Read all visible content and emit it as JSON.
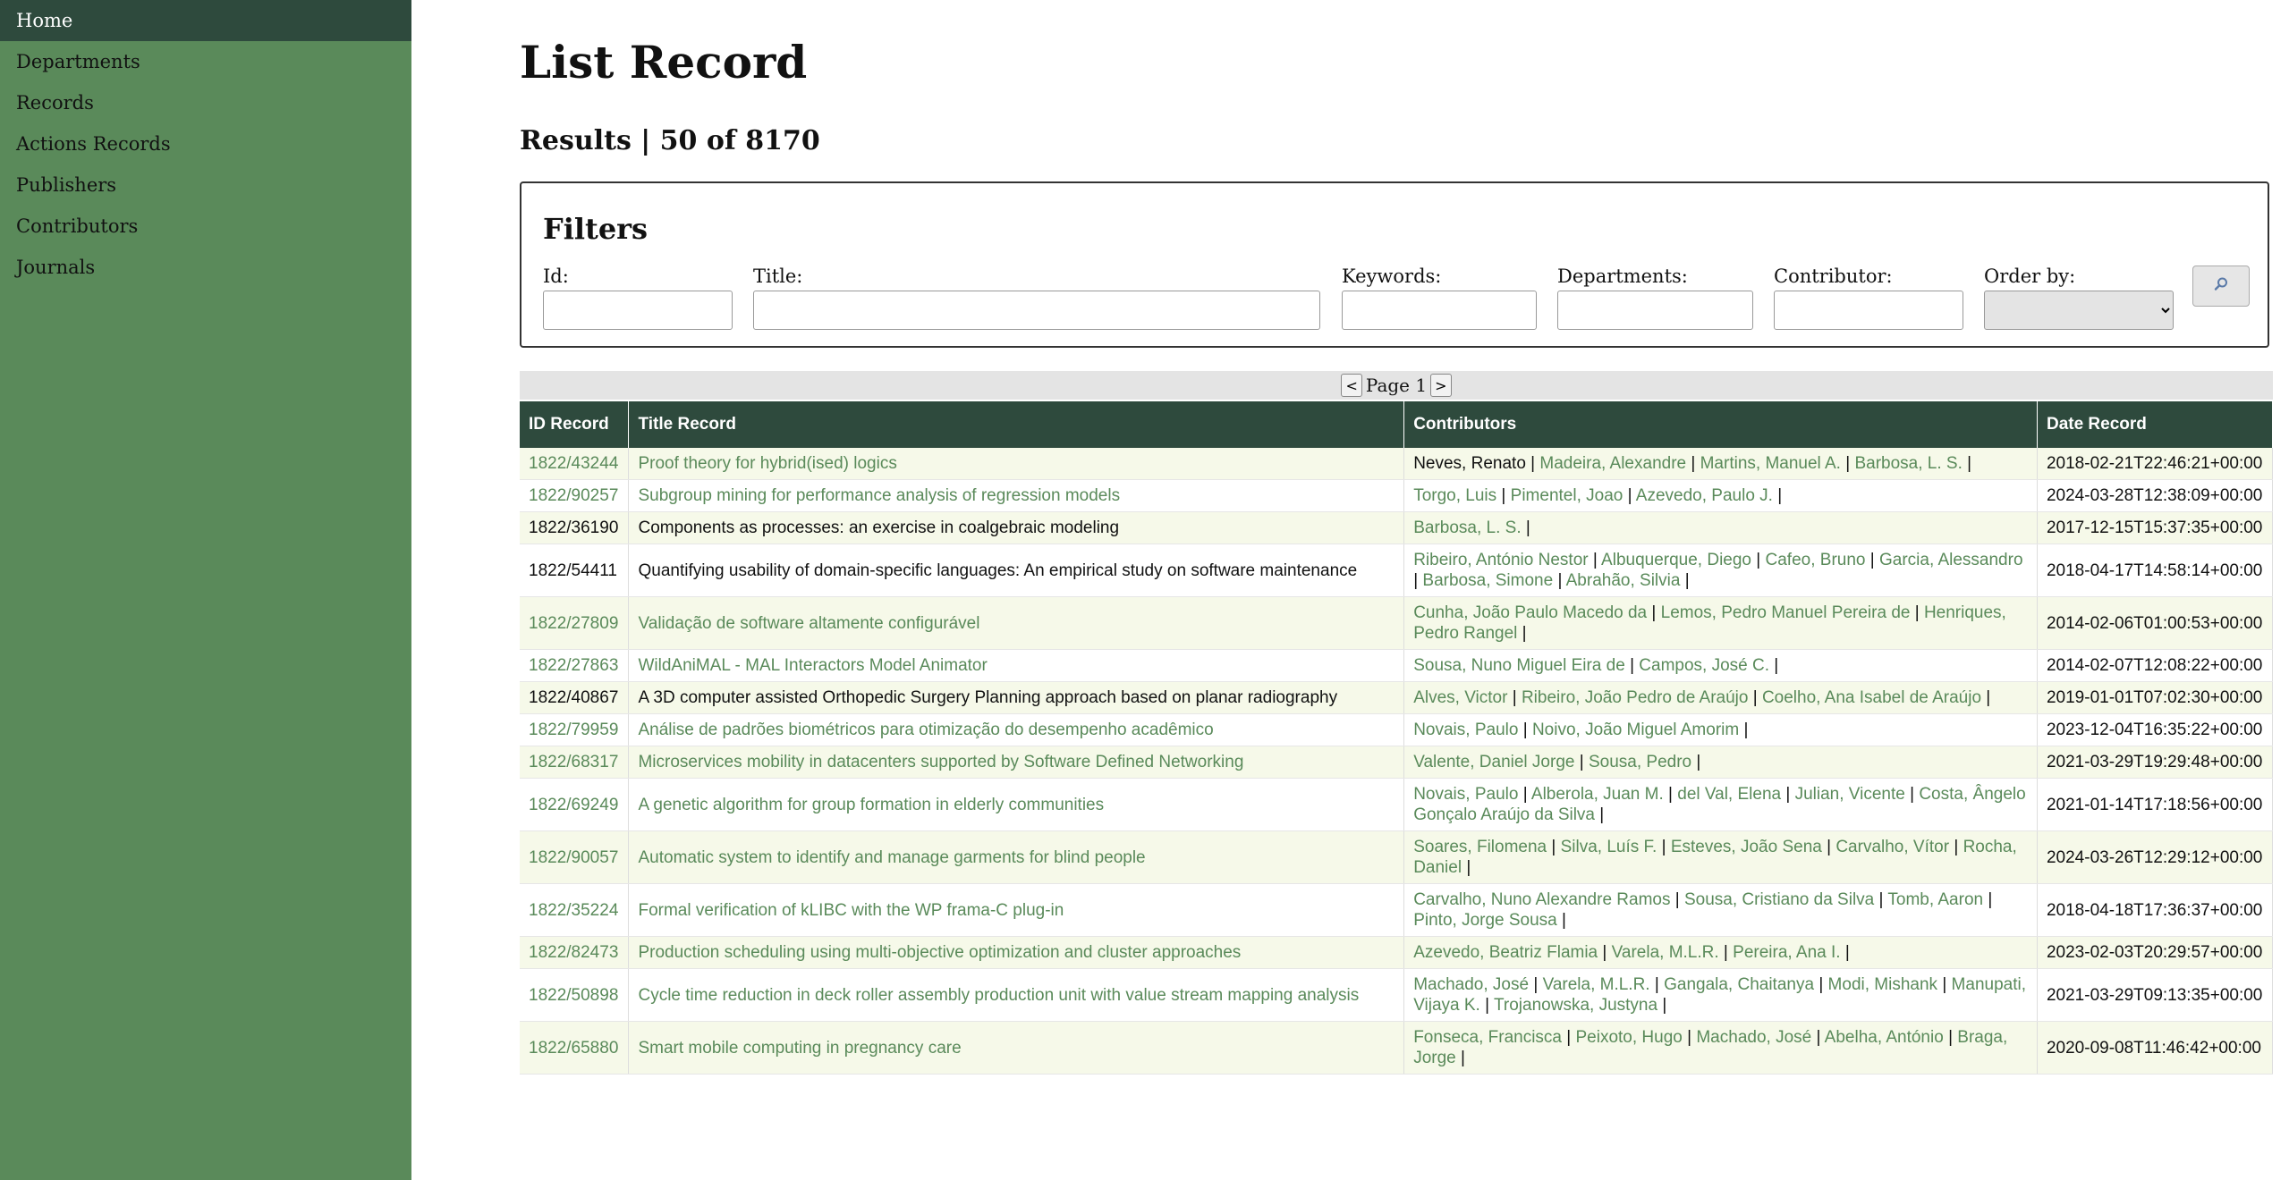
{
  "sidebar": {
    "items": [
      {
        "label": "Home",
        "active": true
      },
      {
        "label": "Departments"
      },
      {
        "label": "Records"
      },
      {
        "label": "Actions Records"
      },
      {
        "label": "Publishers"
      },
      {
        "label": "Contributors"
      },
      {
        "label": "Journals"
      }
    ]
  },
  "page": {
    "title": "List Record",
    "results": "Results | 50 of 8170"
  },
  "filters": {
    "title": "Filters",
    "id_label": "Id:",
    "title_label": "Title:",
    "keywords_label": "Keywords:",
    "departments_label": "Departments:",
    "contributor_label": "Contributor:",
    "order_label": "Order by:",
    "search_icon": "magnifier-icon"
  },
  "pager": {
    "prev": "<",
    "label": "Page 1",
    "next": ">"
  },
  "table": {
    "headers": [
      "ID Record",
      "Title Record",
      "Contributors",
      "Date Record"
    ],
    "rows": [
      {
        "id": "1822/43244",
        "title": "Proof theory for hybrid(ised) logics",
        "linked": true,
        "contributors": [
          {
            "name": "Neves, Renato",
            "link": false
          },
          {
            "name": "Madeira, Alexandre",
            "link": true
          },
          {
            "name": "Martins, Manuel A.",
            "link": true
          },
          {
            "name": "Barbosa, L. S.",
            "link": true
          }
        ],
        "date": "2018-02-21T22:46:21+00:00"
      },
      {
        "id": "1822/90257",
        "title": "Subgroup mining for performance analysis of regression models",
        "linked": true,
        "contributors": [
          {
            "name": "Torgo, Luis",
            "link": true
          },
          {
            "name": "Pimentel, Joao",
            "link": true
          },
          {
            "name": "Azevedo, Paulo J.",
            "link": true
          }
        ],
        "date": "2024-03-28T12:38:09+00:00"
      },
      {
        "id": "1822/36190",
        "title": "Components as processes: an exercise in coalgebraic modeling",
        "linked": false,
        "contributors": [
          {
            "name": "Barbosa, L. S.",
            "link": true
          }
        ],
        "date": "2017-12-15T15:37:35+00:00"
      },
      {
        "id": "1822/54411",
        "title": "Quantifying usability of domain-specific languages: An empirical study on software maintenance",
        "linked": false,
        "contributors": [
          {
            "name": "Ribeiro, António Nestor",
            "link": true
          },
          {
            "name": "Albuquerque, Diego",
            "link": true
          },
          {
            "name": "Cafeo, Bruno",
            "link": true
          },
          {
            "name": "Garcia, Alessandro",
            "link": true
          },
          {
            "name": "Barbosa, Simone",
            "link": true
          },
          {
            "name": "Abrahão, Silvia",
            "link": true
          }
        ],
        "date": "2018-04-17T14:58:14+00:00"
      },
      {
        "id": "1822/27809",
        "title": "Validação de software altamente configurável",
        "linked": true,
        "contributors": [
          {
            "name": "Cunha, João Paulo Macedo da",
            "link": true
          },
          {
            "name": "Lemos, Pedro Manuel Pereira de",
            "link": true
          },
          {
            "name": "Henriques, Pedro Rangel",
            "link": true
          }
        ],
        "date": "2014-02-06T01:00:53+00:00"
      },
      {
        "id": "1822/27863",
        "title": "WildAniMAL - MAL Interactors Model Animator",
        "linked": true,
        "contributors": [
          {
            "name": "Sousa, Nuno Miguel Eira de",
            "link": true
          },
          {
            "name": "Campos, José C.",
            "link": true
          }
        ],
        "date": "2014-02-07T12:08:22+00:00"
      },
      {
        "id": "1822/40867",
        "title": "A 3D computer assisted Orthopedic Surgery Planning approach based on planar radiography",
        "linked": false,
        "contributors": [
          {
            "name": "Alves, Victor",
            "link": true
          },
          {
            "name": "Ribeiro, João Pedro de Araújo",
            "link": true
          },
          {
            "name": "Coelho, Ana Isabel de Araújo",
            "link": true
          }
        ],
        "date": "2019-01-01T07:02:30+00:00"
      },
      {
        "id": "1822/79959",
        "title": "Análise de padrões biométricos para otimização do desempenho acadêmico",
        "linked": true,
        "contributors": [
          {
            "name": "Novais, Paulo",
            "link": true
          },
          {
            "name": "Noivo, João Miguel Amorim",
            "link": true
          }
        ],
        "date": "2023-12-04T16:35:22+00:00"
      },
      {
        "id": "1822/68317",
        "title": "Microservices mobility in datacenters supported by Software Defined Networking",
        "linked": true,
        "contributors": [
          {
            "name": "Valente, Daniel Jorge",
            "link": true
          },
          {
            "name": "Sousa, Pedro",
            "link": true
          }
        ],
        "date": "2021-03-29T19:29:48+00:00"
      },
      {
        "id": "1822/69249",
        "title": "A genetic algorithm for group formation in elderly communities",
        "linked": true,
        "contributors": [
          {
            "name": "Novais, Paulo",
            "link": true
          },
          {
            "name": "Alberola, Juan M.",
            "link": true
          },
          {
            "name": "del Val, Elena",
            "link": true
          },
          {
            "name": "Julian, Vicente",
            "link": true
          },
          {
            "name": "Costa, Ângelo Gonçalo Araújo da Silva",
            "link": true
          }
        ],
        "date": "2021-01-14T17:18:56+00:00"
      },
      {
        "id": "1822/90057",
        "title": "Automatic system to identify and manage garments for blind people",
        "linked": true,
        "contributors": [
          {
            "name": "Soares, Filomena",
            "link": true
          },
          {
            "name": "Silva, Luís F.",
            "link": true
          },
          {
            "name": "Esteves, João Sena",
            "link": true
          },
          {
            "name": "Carvalho, Vítor",
            "link": true
          },
          {
            "name": "Rocha, Daniel",
            "link": true
          }
        ],
        "date": "2024-03-26T12:29:12+00:00"
      },
      {
        "id": "1822/35224",
        "title": "Formal verification of kLIBC with the WP frama-C plug-in",
        "linked": true,
        "contributors": [
          {
            "name": "Carvalho, Nuno Alexandre Ramos",
            "link": true
          },
          {
            "name": "Sousa, Cristiano da Silva",
            "link": true
          },
          {
            "name": "Tomb, Aaron",
            "link": true
          },
          {
            "name": "Pinto, Jorge Sousa",
            "link": true
          }
        ],
        "date": "2018-04-18T17:36:37+00:00"
      },
      {
        "id": "1822/82473",
        "title": "Production scheduling using multi-objective optimization and cluster approaches",
        "linked": true,
        "contributors": [
          {
            "name": "Azevedo, Beatriz Flamia",
            "link": true
          },
          {
            "name": "Varela, M.L.R.",
            "link": true
          },
          {
            "name": "Pereira, Ana I.",
            "link": true
          }
        ],
        "date": "2023-02-03T20:29:57+00:00"
      },
      {
        "id": "1822/50898",
        "title": "Cycle time reduction in deck roller assembly production unit with value stream mapping analysis",
        "linked": true,
        "contributors": [
          {
            "name": "Machado, José",
            "link": true
          },
          {
            "name": "Varela, M.L.R.",
            "link": true
          },
          {
            "name": "Gangala, Chaitanya",
            "link": true
          },
          {
            "name": "Modi, Mishank",
            "link": true
          },
          {
            "name": "Manupati, Vijaya K.",
            "link": true
          },
          {
            "name": "Trojanowska, Justyna",
            "link": true
          }
        ],
        "date": "2021-03-29T09:13:35+00:00"
      },
      {
        "id": "1822/65880",
        "title": "Smart mobile computing in pregnancy care",
        "linked": true,
        "contributors": [
          {
            "name": "Fonseca, Francisca",
            "link": true
          },
          {
            "name": "Peixoto, Hugo",
            "link": true
          },
          {
            "name": "Machado, José",
            "link": true
          },
          {
            "name": "Abelha, António",
            "link": true
          },
          {
            "name": "Braga, Jorge",
            "link": true
          }
        ],
        "date": "2020-09-08T11:46:42+00:00"
      }
    ]
  }
}
